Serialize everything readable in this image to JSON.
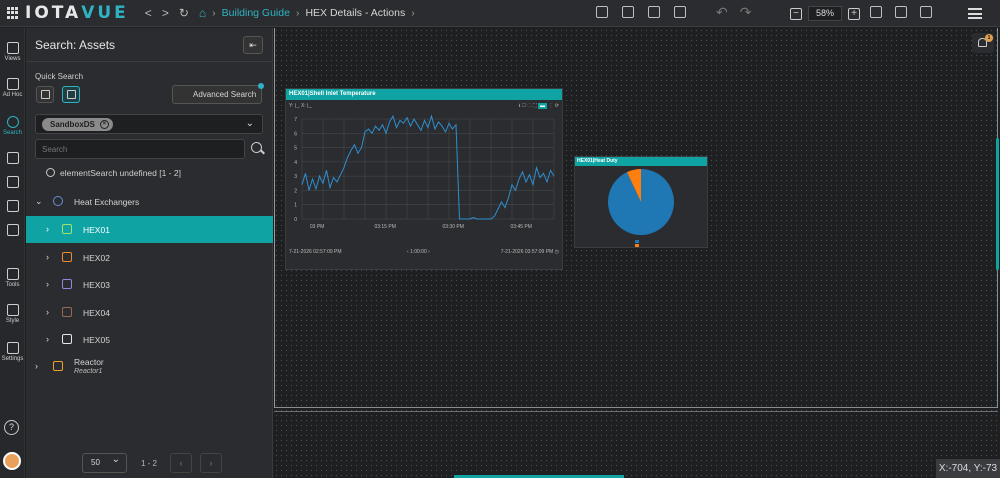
{
  "app": {
    "logo_a": "IOTA",
    "logo_b": "VUE"
  },
  "breadcrumb": {
    "link": "Building Guide",
    "current": "HEX Details - Actions"
  },
  "toolbar": {
    "zoom": "58%"
  },
  "nav": [
    {
      "label": "Views",
      "icon": "views-icon"
    },
    {
      "label": "Ad Hoc",
      "icon": "adhoc-icon"
    },
    {
      "label": "Search",
      "icon": "search-icon"
    },
    {
      "label": "",
      "icon": "tag-icon"
    },
    {
      "label": "",
      "icon": "hierarchy-icon"
    },
    {
      "label": "",
      "icon": "database-icon"
    },
    {
      "label": "",
      "icon": "calc-icon"
    },
    {
      "label": "Tools",
      "icon": "tools-icon"
    },
    {
      "label": "Style",
      "icon": "style-icon"
    },
    {
      "label": "Settings",
      "icon": "gear-icon"
    }
  ],
  "panel": {
    "title": "Search: Assets",
    "quick_search": "Quick Search",
    "advanced": "Advanced Search",
    "chip": "SandboxDS",
    "search_placeholder": "Search",
    "result": "elementSearch undefined [1 - 2]",
    "tree": {
      "root": "Heat Exchangers",
      "items": [
        "HEX01",
        "HEX02",
        "HEX03",
        "HEX04",
        "HEX05"
      ],
      "reactor": "Reactor",
      "reactor_sub": "Reactor1"
    },
    "page_size": "50",
    "page_range": "1 - 2"
  },
  "trend": {
    "title": "HEX01|Shell Inlet Temperature",
    "tools": "Y: ⌊_ X: ⌊_",
    "start": "7-21-2026 02:57:09 PM",
    "span": "1:00:00",
    "end": "7-21-2026 03:57:09 PM",
    "chart_data": {
      "type": "line",
      "x": [
        "03 PM",
        "03:15 PM",
        "03:30 PM",
        "03:45 PM"
      ],
      "ylim": [
        0,
        7
      ],
      "yticks": [
        0,
        1,
        2,
        3,
        4,
        5,
        6,
        7
      ],
      "series": [
        {
          "values": [
            2.4,
            3.2,
            2.0,
            2.8,
            2.1,
            3.0,
            2.5,
            3.4,
            2.2,
            2.9,
            2.6,
            3.1,
            3.6,
            4.3,
            4.8,
            5.2,
            4.6,
            5.0,
            6.1,
            6.3,
            6.0,
            6.5,
            6.2,
            6.6,
            6.0,
            6.8,
            7.2,
            6.4,
            6.9,
            6.7,
            7.1,
            6.5,
            7.0,
            6.6,
            6.2,
            6.9,
            6.4,
            7.2,
            6.3,
            6.8,
            6.5,
            6.1,
            6.7,
            6.3,
            6.6,
            0.0,
            0.0,
            0.0,
            0.0,
            0.1,
            0.0,
            0.0,
            0.0,
            0.0,
            0.0,
            0.2,
            0.7,
            1.2,
            0.8,
            1.5,
            2.4,
            2.0,
            2.8,
            3.3,
            2.6,
            3.1,
            2.4,
            3.6,
            2.9,
            3.2,
            2.6,
            3.4,
            3.0
          ]
        }
      ]
    }
  },
  "pie": {
    "title": "HEX01|Heat Duty",
    "chart_data": {
      "type": "pie",
      "values": [
        93,
        7
      ],
      "colors": [
        "#1f77b4",
        "#ff7f0e"
      ]
    }
  },
  "status": {
    "coords": "X:-704, Y:-73"
  }
}
